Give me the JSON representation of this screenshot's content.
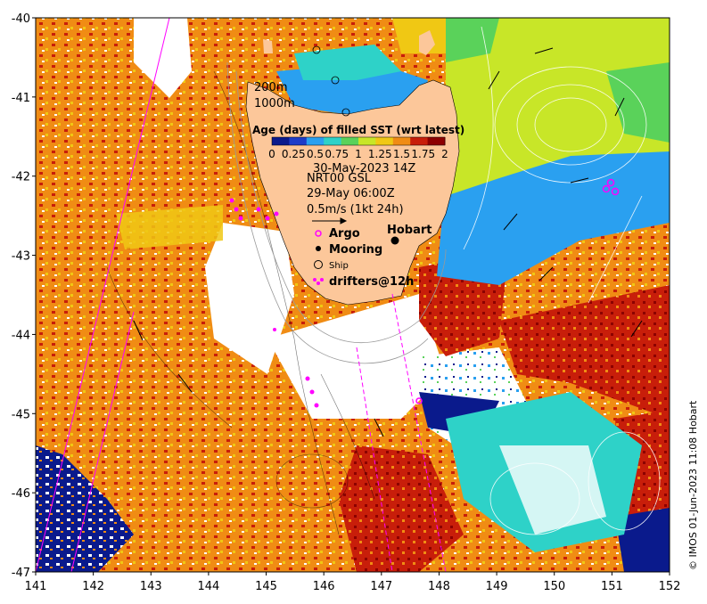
{
  "map": {
    "lon_ticks": [
      "141",
      "142",
      "143",
      "144",
      "145",
      "146",
      "147",
      "148",
      "149",
      "150",
      "151",
      "152"
    ],
    "lat_ticks": [
      "-40",
      "-41",
      "-42",
      "-43",
      "-44",
      "-45",
      "-46",
      "-47"
    ],
    "lon_range": [
      141,
      152
    ],
    "lat_range": [
      -47,
      -40
    ]
  },
  "bathymetry": {
    "contour_200": "200m",
    "contour_1000": "1000m"
  },
  "colorbar": {
    "title": "Age (days) of filled SST (wrt latest)",
    "ticks": [
      "0",
      "0.25",
      "0.5",
      "0.75",
      "1",
      "1.25",
      "1.5",
      "1.75",
      "2"
    ],
    "colors": [
      "#0a1a8c",
      "#1e3cc8",
      "#2aa0f0",
      "#2ed2c8",
      "#5ad25a",
      "#c8e628",
      "#f0c814",
      "#f08c14",
      "#c81e0a",
      "#8c0000"
    ]
  },
  "info": {
    "sst_time": "30-May-2023 14Z",
    "current_source": "NRT00 GSL",
    "current_time": "29-May 06:00Z",
    "vector_scale": "0.5m/s (1kt 24h)"
  },
  "legend": {
    "argo": "Argo",
    "mooring": "Mooring",
    "ship": "Ship",
    "drifters": "drifters@12h",
    "city": "Hobart"
  },
  "colors": {
    "land": "#fcc79a",
    "argo": "#ff00ff",
    "drifter": "#ff00ff",
    "ocean_white": "#ffffff"
  },
  "copyright": "© IMOS 01-Jun-2023 11:08 Hobart"
}
